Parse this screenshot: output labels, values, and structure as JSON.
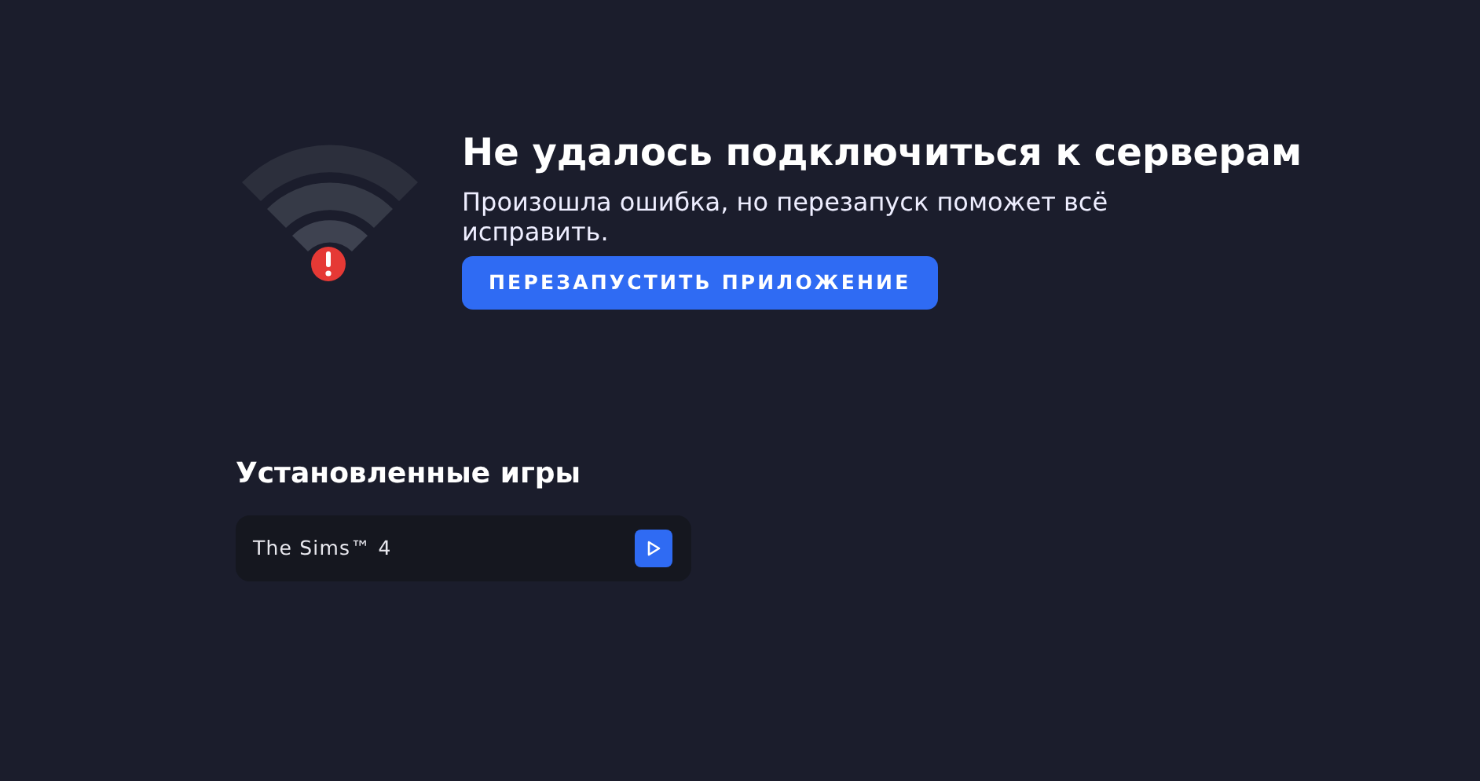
{
  "error": {
    "title": "Не удалось подключиться к серверам",
    "message": "Произошла ошибка, но перезапуск поможет всё исправить.",
    "button": "ПЕРЕЗАПУСТИТЬ ПРИЛОЖЕНИЕ"
  },
  "installed_games": {
    "heading": "Установленные игры",
    "games": [
      {
        "name": "The Sims™ 4"
      }
    ]
  }
}
